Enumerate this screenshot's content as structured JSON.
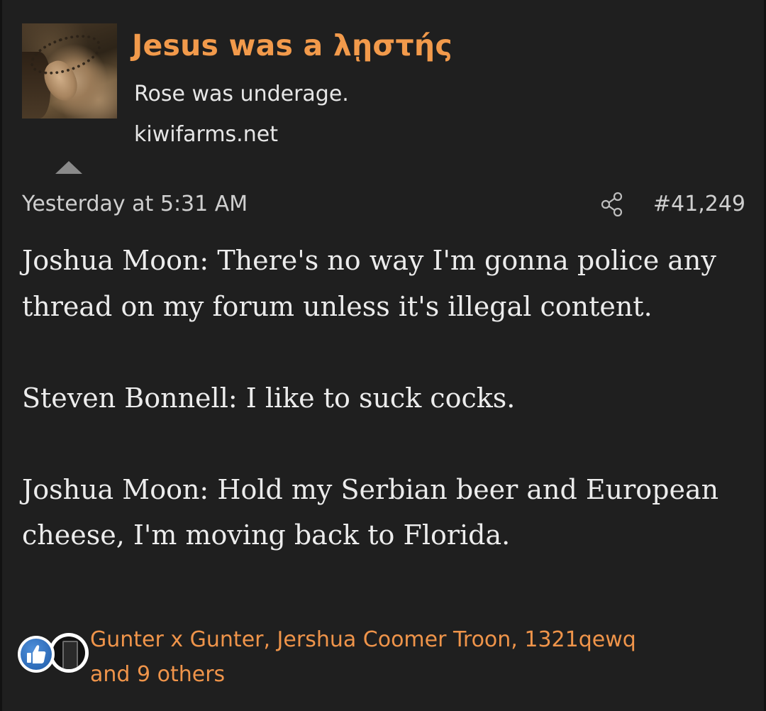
{
  "post": {
    "title": "Jesus was a λῃστής",
    "subtitle": "Rose was underage.",
    "domain": "kiwifarms.net",
    "timestamp": "Yesterday at 5:31 AM",
    "post_number": "#41,249",
    "body": [
      "Joshua Moon: There's no way I'm gonna police any thread on my forum unless it's illegal content.",
      "Steven Bonnell: I like to suck cocks.",
      "Joshua Moon: Hold my Serbian beer and European cheese, I'm moving back to Florida."
    ],
    "reactions": {
      "names_line": "Gunter x Gunter, Jershua Coomer Troon, 1321qewq",
      "others_line": "and 9 others",
      "icons": [
        "like-icon",
        "winner-icon"
      ]
    }
  },
  "icons": {
    "collapse": "triangle-up-icon",
    "share": "share-icon"
  },
  "colors": {
    "background": "#1f1f1f",
    "accent": "#f29a4b",
    "text": "#ececec",
    "muted": "#cfcfcf"
  }
}
